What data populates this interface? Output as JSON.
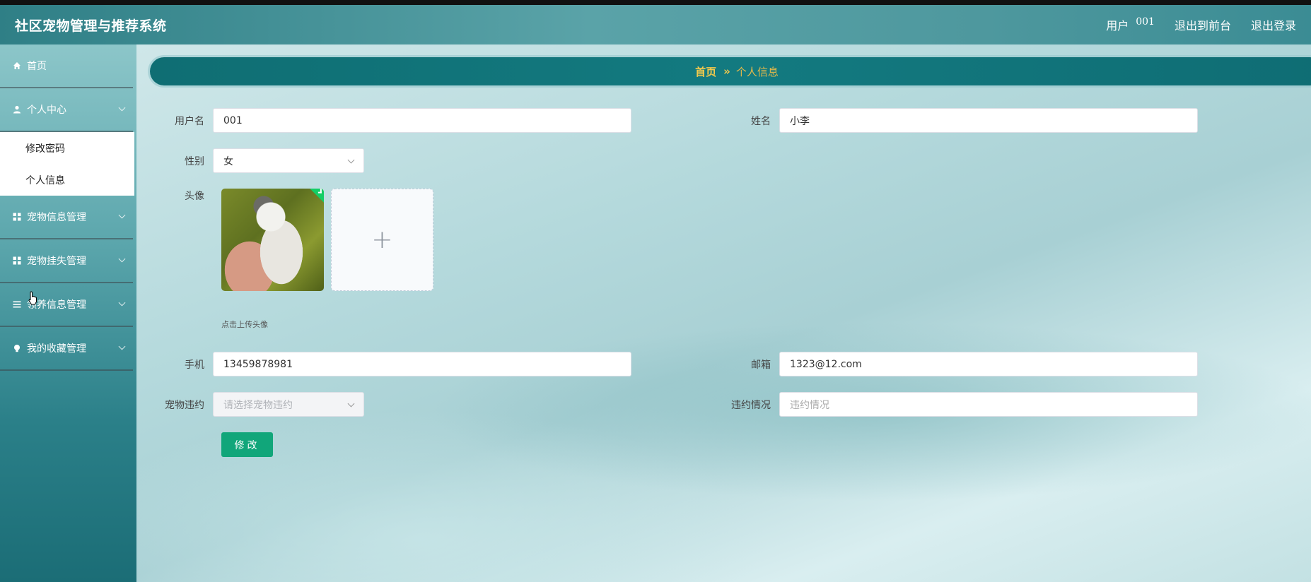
{
  "header": {
    "app_title": "社区宠物管理与推荐系统",
    "user_label": "用户",
    "user_value": "001",
    "to_front": "退出到前台",
    "logout": "退出登录"
  },
  "sidebar": {
    "items": [
      {
        "label": "首页",
        "icon": "home-icon"
      },
      {
        "label": "个人中心",
        "icon": "user-icon",
        "sub": [
          "修改密码",
          "个人信息"
        ]
      },
      {
        "label": "宠物信息管理",
        "icon": "grid-icon"
      },
      {
        "label": "宠物挂失管理",
        "icon": "grid-icon"
      },
      {
        "label": "领养信息管理",
        "icon": "list-icon"
      },
      {
        "label": "我的收藏管理",
        "icon": "bulb-icon"
      }
    ]
  },
  "breadcrumb": {
    "home": "首页",
    "separator": "»",
    "current": "个人信息"
  },
  "form": {
    "username_label": "用户名",
    "username_value": "001",
    "name_label": "姓名",
    "name_value": "小李",
    "gender_label": "性别",
    "gender_value": "女",
    "avatar_label": "头像",
    "avatar_hint": "点击上传头像",
    "upload_plus": "+",
    "phone_label": "手机",
    "phone_value": "13459878981",
    "email_label": "邮箱",
    "email_value": "1323@12.com",
    "violation_label": "宠物违约",
    "violation_placeholder": "请选择宠物违约",
    "violation_status_label": "违约情况",
    "violation_status_placeholder": "违约情况",
    "submit_label": "修改"
  },
  "colors": {
    "accent": "#11a67a",
    "breadcrumb_bg": "#137a80",
    "breadcrumb_text": "#f2c94c"
  }
}
